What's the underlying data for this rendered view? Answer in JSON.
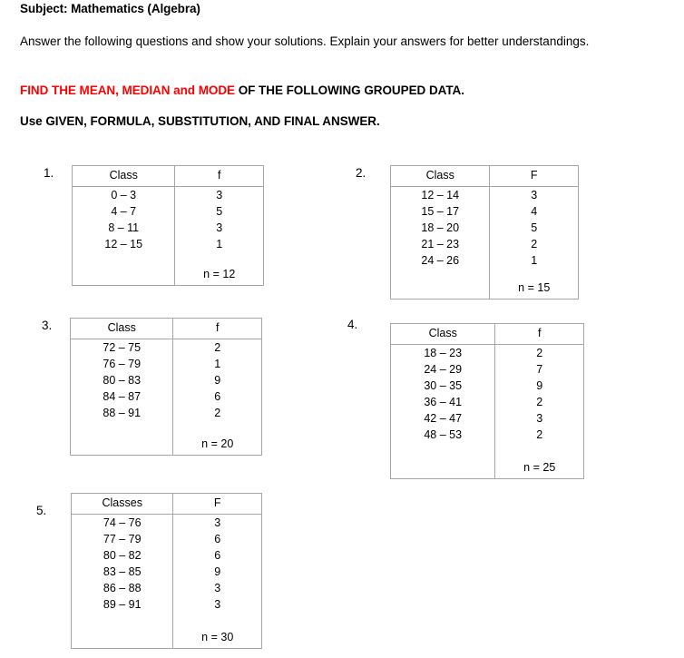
{
  "document": {
    "subject": "Subject: Mathematics (Algebra)",
    "instructions": "Answer the following questions and show your solutions. Explain your answers for better understandings.",
    "find_directive_red": "FIND THE MEAN, MEDIAN and MODE",
    "find_directive_black": " OF THE FOLLOWING GROUPED DATA.",
    "use_directive": "Use GIVEN, FORMULA, SUBSTITUTION, AND FINAL ANSWER.",
    "accent_color": "#FF0000",
    "border_color": "#A6A6A6"
  },
  "questions": [
    {
      "number": "1.",
      "headers": {
        "class": "Class",
        "freq": "f"
      },
      "rows": [
        {
          "class": "0 – 3",
          "freq": "3"
        },
        {
          "class": "4 – 7",
          "freq": "5"
        },
        {
          "class": "8 – 11",
          "freq": "3"
        },
        {
          "class": "12 – 15",
          "freq": "1"
        }
      ],
      "total": "n = 12"
    },
    {
      "number": "2.",
      "headers": {
        "class": "Class",
        "freq": "F"
      },
      "rows": [
        {
          "class": "12 – 14",
          "freq": "3"
        },
        {
          "class": "15 – 17",
          "freq": "4"
        },
        {
          "class": "18 – 20",
          "freq": "5"
        },
        {
          "class": "21 – 23",
          "freq": "2"
        },
        {
          "class": "24 – 26",
          "freq": "1"
        }
      ],
      "total": "n = 15"
    },
    {
      "number": "3.",
      "headers": {
        "class": "Class",
        "freq": "f"
      },
      "rows": [
        {
          "class": "72 – 75",
          "freq": "2"
        },
        {
          "class": "76 – 79",
          "freq": "1"
        },
        {
          "class": "80 – 83",
          "freq": "9"
        },
        {
          "class": "84 – 87",
          "freq": "6"
        },
        {
          "class": "88 – 91",
          "freq": "2"
        }
      ],
      "total": "n = 20"
    },
    {
      "number": "4.",
      "headers": {
        "class": "Class",
        "freq": "f"
      },
      "rows": [
        {
          "class": "18 – 23",
          "freq": "2"
        },
        {
          "class": "24 – 29",
          "freq": "7"
        },
        {
          "class": "30 – 35",
          "freq": "9"
        },
        {
          "class": "36 – 41",
          "freq": "2"
        },
        {
          "class": "42 – 47",
          "freq": "3"
        },
        {
          "class": "48 – 53",
          "freq": "2"
        }
      ],
      "total": "n = 25"
    },
    {
      "number": "5.",
      "headers": {
        "class": "Classes",
        "freq": "F"
      },
      "rows": [
        {
          "class": "74 – 76",
          "freq": "3"
        },
        {
          "class": "77 – 79",
          "freq": "6"
        },
        {
          "class": "80 – 82",
          "freq": "6"
        },
        {
          "class": "83 – 85",
          "freq": "9"
        },
        {
          "class": "86 – 88",
          "freq": "3"
        },
        {
          "class": "89 – 91",
          "freq": "3"
        }
      ],
      "total": "n = 30"
    }
  ]
}
